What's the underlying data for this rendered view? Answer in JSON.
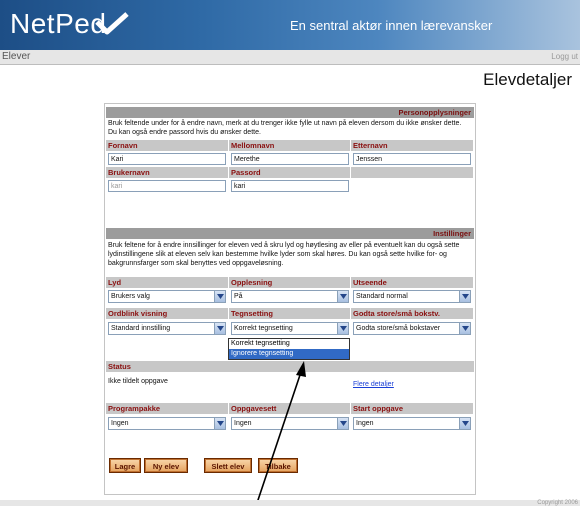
{
  "header": {
    "logo": "NetPed",
    "slogan": "En sentral aktør innen lærevansker"
  },
  "nav": {
    "left": "Elever",
    "right": "Logg ut"
  },
  "page": {
    "title": "Elevdetaljer"
  },
  "personal": {
    "section_title": "Personopplysninger",
    "description": "Bruk feltende under for å endre navn, merk at du trenger ikke fylle ut navn på eleven dersom du ikke ønsker dette. Du kan også endre passord hvis du ønsker dette.",
    "fornavn_label": "Fornavn",
    "fornavn_value": "Kari",
    "mellomnavn_label": "Mellomnavn",
    "mellomnavn_value": "Merethe",
    "etternavn_label": "Etternavn",
    "etternavn_value": "Jenssen",
    "brukernavn_label": "Brukernavn",
    "brukernavn_value": "kari",
    "passord_label": "Passord",
    "passord_value": "kari"
  },
  "settings": {
    "section_title": "Instillinger",
    "description": "Bruk feltene for å endre innsillinger for eleven ved å skru lyd og høytlesing av eller på eventuelt kan du også sette lydinstillingene slik at eleven selv kan bestemme hvilke lyder som skal høres. Du kan også sette hvilke for- og bakgrunnsfarger som skal benyttes ved oppgaveløsning.",
    "lyd_label": "Lyd",
    "lyd_value": "Brukers valg",
    "opplesning_label": "Opplesning",
    "opplesning_value": "På",
    "utseende_label": "Utseende",
    "utseende_value": "Standard normal",
    "ordblink_label": "Ordblink visning",
    "ordblink_value": "Standard innstilling",
    "tegnsetting_label": "Tegnsetting",
    "tegnsetting_value": "Korrekt tegnsetting",
    "tegnsetting_options": [
      "Korrekt tegnsetting",
      "Ignorere tegnsetting"
    ],
    "godta_label": "Godta store/små bokstv.",
    "godta_value": "Godta store/små bokstaver"
  },
  "status": {
    "label": "Status",
    "text": "Ikke tildelt oppgave",
    "link": "Flere detaljer"
  },
  "assign": {
    "programpakke_label": "Programpakke",
    "programpakke_value": "Ingen",
    "oppgavesett_label": "Oppgavesett",
    "oppgavesett_value": "Ingen",
    "start_label": "Start oppgave",
    "start_value": "Ingen"
  },
  "buttons": {
    "lagre": "Lagre",
    "ny": "Ny elev",
    "slett": "Slett elev",
    "tilbake": "Tilbake"
  },
  "footer": {
    "copyright": "Copyright 2006"
  },
  "colors": {
    "banner": "#2f6aa6",
    "section_bar": "#9c9c9c",
    "label_text": "#8a1010",
    "button": "#e7a765",
    "selection": "#316ac5"
  }
}
